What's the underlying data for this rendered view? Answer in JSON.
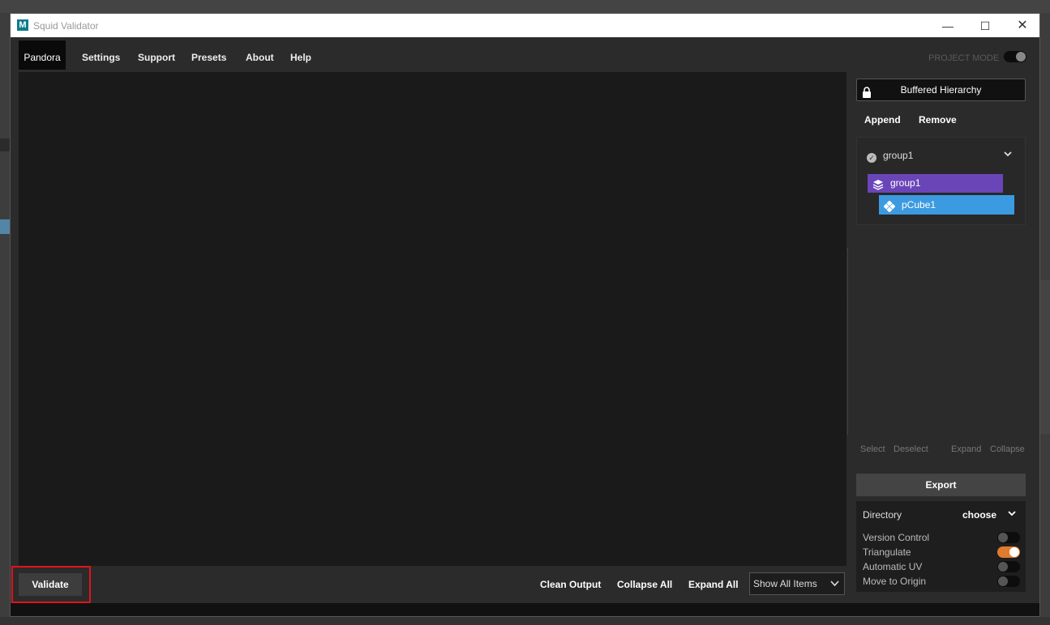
{
  "window": {
    "title": "Squid Validator",
    "icon_letter": "M",
    "controls": {
      "minimize": "—",
      "maximize": "☐",
      "close": "✕"
    }
  },
  "menu": {
    "items": [
      "Pandora",
      "Settings",
      "Support",
      "Presets",
      "About",
      "Help"
    ],
    "active": "Pandora",
    "project_mode_label": "PROJECT MODE",
    "project_mode_on": false
  },
  "bottombar": {
    "validate_label": "Validate",
    "clean_output_label": "Clean Output",
    "collapse_all_label": "Collapse All",
    "expand_all_label": "Expand All",
    "show_select_value": "Show All Items"
  },
  "right_panel": {
    "buffered_label": "Buffered Hierarchy",
    "append_label": "Append",
    "remove_label": "Remove",
    "tree": {
      "root": "group1",
      "nodes": [
        {
          "label": "group1",
          "type": "group",
          "color": "#6a45b8"
        },
        {
          "label": "pCube1",
          "type": "mesh",
          "color": "#3c9ae0"
        }
      ]
    },
    "tree_actions": [
      "Select",
      "Deselect",
      "Expand",
      "Collapse"
    ],
    "export_label": "Export",
    "directory_label": "Directory",
    "directory_value": "choose",
    "options": [
      {
        "label": "Version Control",
        "on": false
      },
      {
        "label": "Triangulate",
        "on": true
      },
      {
        "label": "Automatic UV",
        "on": false
      },
      {
        "label": "Move to Origin",
        "on": false
      }
    ]
  },
  "colors": {
    "accent_toggle": "#e07b2e",
    "highlight_border": "#e0141a",
    "group_node": "#6a45b8",
    "mesh_node": "#3c9ae0"
  }
}
